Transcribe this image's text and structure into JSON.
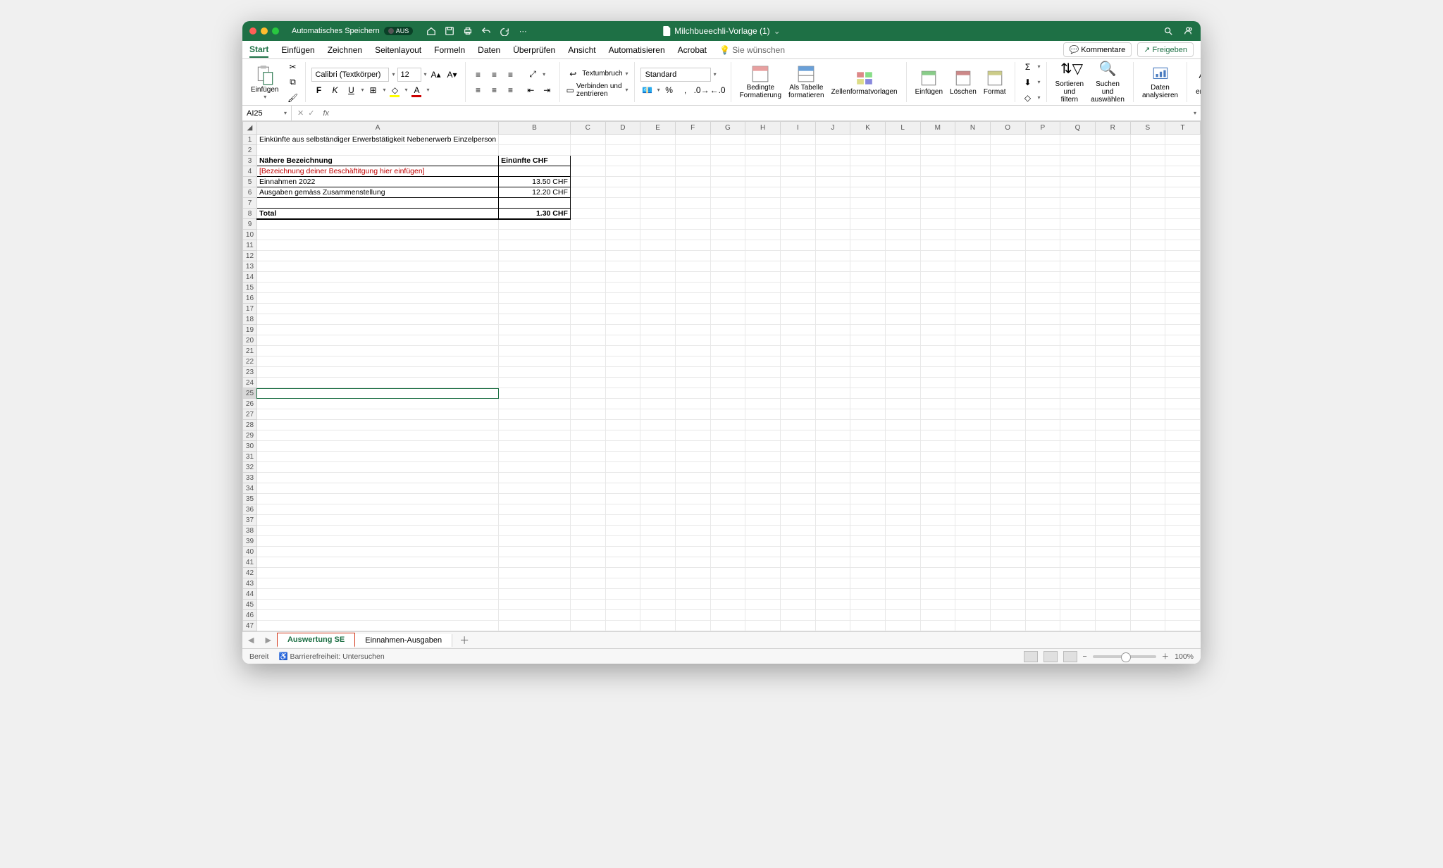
{
  "titlebar": {
    "autosave_label": "Automatisches Speichern",
    "autosave_state": "AUS",
    "filename": "Milchbueechli-Vorlage (1)"
  },
  "menu": {
    "items": [
      "Start",
      "Einfügen",
      "Zeichnen",
      "Seitenlayout",
      "Formeln",
      "Daten",
      "Überprüfen",
      "Ansicht",
      "Automatisieren",
      "Acrobat",
      "Sie wünschen"
    ],
    "kommentare": "Kommentare",
    "freigeben": "Freigeben"
  },
  "ribbon": {
    "paste": "Einfügen",
    "font_name": "Calibri (Textkörper)",
    "font_size": "12",
    "wrap": "Textumbruch",
    "merge": "Verbinden und zentrieren",
    "number_format": "Standard",
    "cond_fmt": "Bedingte\nFormatierung",
    "as_table": "Als Tabelle\nformatieren",
    "cell_styles": "Zellenformatvorlagen",
    "insert": "Einfügen",
    "delete": "Löschen",
    "format": "Format",
    "sort": "Sortieren\nund filtern",
    "find": "Suchen und\nauswählen",
    "analyze": "Daten\nanalysieren",
    "pdf": "Adobe PDF\nerstellen und teilen"
  },
  "namebox": {
    "cell": "AI25",
    "fx": "fx"
  },
  "columns": [
    "A",
    "B",
    "C",
    "D",
    "E",
    "F",
    "G",
    "H",
    "I",
    "J",
    "K",
    "L",
    "M",
    "N",
    "O",
    "P",
    "Q",
    "R",
    "S",
    "T"
  ],
  "rows_count": 47,
  "sheet": {
    "r1a": "Einkünfte aus selbständiger Erwerbstätigkeit Nebenerwerb Einzelperson",
    "r3a": "Nähere Bezeichnung",
    "r3b": "Einünfte CHF",
    "r4a": "[Bezeichnung deiner Beschäftitgung hier einfügen]",
    "r5a": "Einnahmen 2022",
    "r5b": "13.50 CHF",
    "r6a": "Ausgaben gemäss Zusammenstellung",
    "r6b": "12.20 CHF",
    "r8a": "Total",
    "r8b": "1.30 CHF"
  },
  "tabs": {
    "active": "Auswertung SE",
    "other": "Einnahmen-Ausgaben"
  },
  "status": {
    "ready": "Bereit",
    "access": "Barrierefreiheit: Untersuchen",
    "zoom": "100%"
  }
}
